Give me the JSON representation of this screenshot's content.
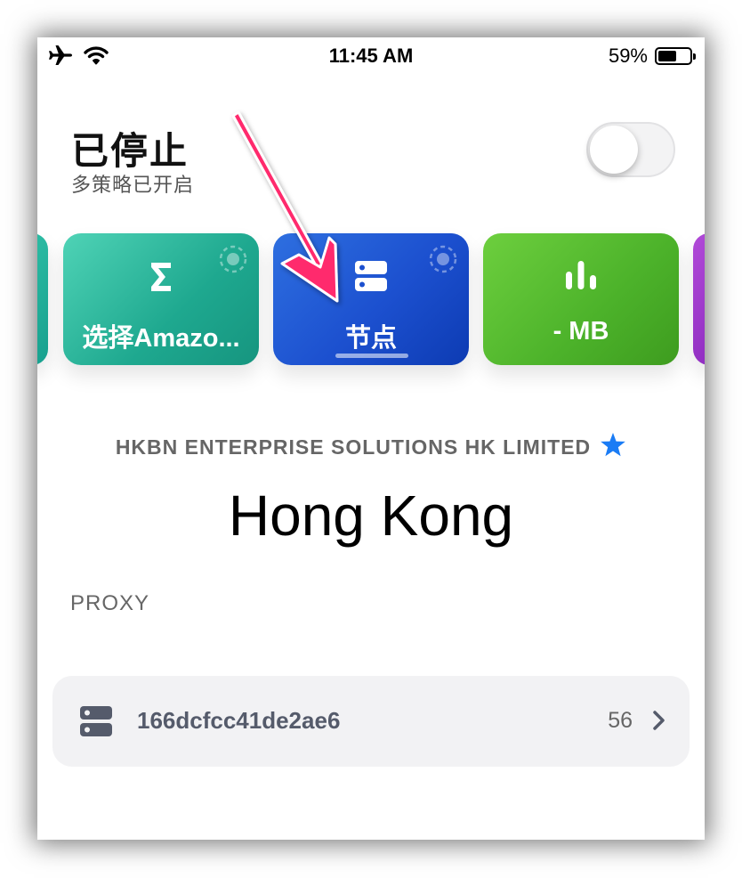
{
  "status_bar": {
    "icons": [
      "airplane-icon",
      "wifi-icon"
    ],
    "time": "11:45 AM",
    "battery_percent": "59%",
    "battery_level": 0.59
  },
  "header": {
    "title": "已停止",
    "subtitle": "多策略已开启",
    "toggle_on": false
  },
  "cards": [
    {
      "label": "选择Amazo...",
      "icon": "sigma-icon",
      "color": "#1ea88f"
    },
    {
      "label": "节点",
      "icon": "server-icon",
      "color": "#1c50cf",
      "selected": true
    },
    {
      "label": "- MB",
      "icon": "bar-chart-icon",
      "color": "#4cb22a"
    }
  ],
  "main": {
    "provider": "HKBN ENTERPRISE SOLUTIONS HK LIMITED",
    "location": "Hong Kong",
    "section_label": "PROXY"
  },
  "proxy": {
    "name": "166dcfcc41de2ae6",
    "count": "56",
    "icon": "server-icon"
  },
  "colors": {
    "annotation_arrow": "#ff2a6d",
    "star": "#1a7cf5"
  }
}
